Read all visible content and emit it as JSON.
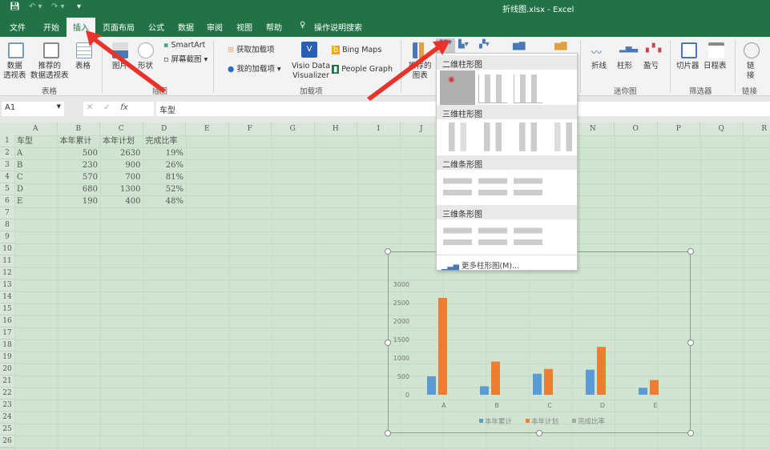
{
  "window": {
    "title": "折线图.xlsx  -  Excel"
  },
  "tabs": [
    "文件",
    "开始",
    "插入",
    "页面布局",
    "公式",
    "数据",
    "审阅",
    "视图",
    "帮助"
  ],
  "active_tab": "插入",
  "tell_me": "操作说明搜索",
  "ribbon": {
    "tables": {
      "pivot": "数据\n透视表",
      "recommended_pivot": "推荐的\n数据透视表",
      "table": "表格",
      "group": "表格"
    },
    "illustrations": {
      "pictures": "图片",
      "shapes": "形状",
      "smartart": "SmartArt",
      "screenshot": "屏幕截图",
      "group": "插图"
    },
    "addins": {
      "get": "获取加载项",
      "my": "我的加载项",
      "visio": "Visio Data\nVisualizer",
      "bing": "Bing Maps",
      "people": "People Graph",
      "group": "加载项"
    },
    "charts": {
      "recommended": "推荐的\n图表"
    },
    "sparklines": {
      "line": "折线",
      "column": "柱形",
      "winloss": "盈亏",
      "group": "迷你图"
    },
    "filters": {
      "slicer": "切片器",
      "timeline": "日程表",
      "group": "筛选器"
    },
    "links": {
      "link": "链\n接",
      "group": "链接"
    }
  },
  "formula_bar": {
    "name_box": "A1",
    "formula": "车型"
  },
  "columns": [
    "A",
    "B",
    "C",
    "D",
    "E",
    "F",
    "G",
    "H",
    "I",
    "J",
    "K",
    "L",
    "M",
    "N",
    "O",
    "P",
    "Q",
    "R"
  ],
  "sheet": {
    "headers": [
      "车型",
      "本年累计",
      "本年计划",
      "完成比率"
    ],
    "rows": [
      [
        "A",
        "500",
        "2630",
        "19%"
      ],
      [
        "B",
        "230",
        "900",
        "26%"
      ],
      [
        "C",
        "570",
        "700",
        "81%"
      ],
      [
        "D",
        "680",
        "1300",
        "52%"
      ],
      [
        "E",
        "190",
        "400",
        "48%"
      ]
    ]
  },
  "dropdown": {
    "sections": [
      "二维柱形图",
      "三维柱形图",
      "二维条形图",
      "三维条形图"
    ],
    "more": "更多柱形图(M)..."
  },
  "chart_data": {
    "type": "bar",
    "categories": [
      "A",
      "B",
      "C",
      "D",
      "E"
    ],
    "series": [
      {
        "name": "本年累计",
        "values": [
          500,
          230,
          570,
          680,
          190
        ],
        "color": "#5b9bd5"
      },
      {
        "name": "本年计划",
        "values": [
          2630,
          900,
          700,
          1300,
          400
        ],
        "color": "#ed7d31"
      },
      {
        "name": "完成比率",
        "values": [
          0.19,
          0.26,
          0.81,
          0.52,
          0.48
        ],
        "color": "#a5a5a5"
      }
    ],
    "yticks": [
      "0",
      "500",
      "1000",
      "1500",
      "2000",
      "2500",
      "3000"
    ],
    "ylim": [
      0,
      3000
    ],
    "legend": "bottom",
    "grid": false
  },
  "colors": {
    "accent": "#217346",
    "annotation_arrow": "#e8322a"
  }
}
